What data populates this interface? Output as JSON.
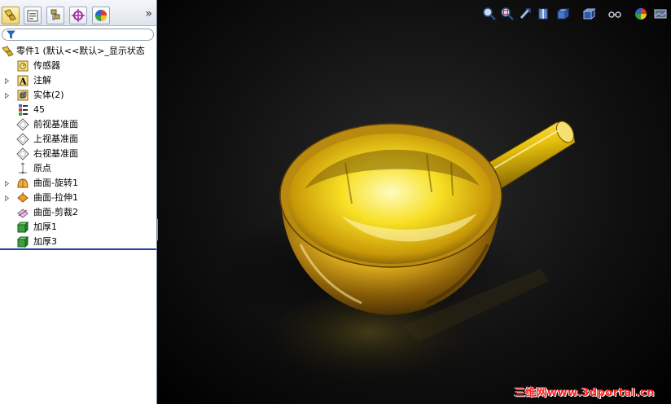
{
  "feature_tree": {
    "root_label": "零件1 (默认<<默认>_显示状态",
    "items": [
      {
        "label": "传感器",
        "icon": "sensor-icon",
        "expandable": false
      },
      {
        "label": "注解",
        "icon": "annotation-icon",
        "expandable": true
      },
      {
        "label": "实体(2)",
        "icon": "solid-bodies-icon",
        "expandable": true
      },
      {
        "label": "45",
        "icon": "material-icon",
        "expandable": false
      },
      {
        "label": "前视基准面",
        "icon": "plane-icon",
        "expandable": false
      },
      {
        "label": "上视基准面",
        "icon": "plane-icon",
        "expandable": false
      },
      {
        "label": "右视基准面",
        "icon": "plane-icon",
        "expandable": false
      },
      {
        "label": "原点",
        "icon": "origin-icon",
        "expandable": false
      },
      {
        "label": "曲面-旋转1",
        "icon": "surface-revolve-icon",
        "expandable": true
      },
      {
        "label": "曲面-拉伸1",
        "icon": "surface-extrude-icon",
        "expandable": true
      },
      {
        "label": "曲面-剪裁2",
        "icon": "surface-trim-icon",
        "expandable": false
      },
      {
        "label": "加厚1",
        "icon": "thicken-icon",
        "expandable": false
      },
      {
        "label": "加厚3",
        "icon": "thicken-icon",
        "expandable": false
      }
    ]
  },
  "panel_tabs": [
    "featuremanager-tab-icon",
    "propertymanager-tab-icon",
    "configurationmanager-tab-icon",
    "dimxpert-tab-icon",
    "display-manager-tab-icon"
  ],
  "heads_up_toolbar": [
    "zoom-to-fit-icon",
    "zoom-to-area-icon",
    "previous-view-icon",
    "section-view-icon",
    "view-orientation-icon",
    "display-style-icon",
    "hide-show-items-icon",
    "edit-appearance-icon",
    "apply-scene-icon"
  ],
  "watermark": "三维网www.3dportal.cn",
  "colors": {
    "viewport_bg": "#000000",
    "gold": "#f5d400",
    "watermark": "#ff2020",
    "rollback_bar": "#1b45a3"
  }
}
